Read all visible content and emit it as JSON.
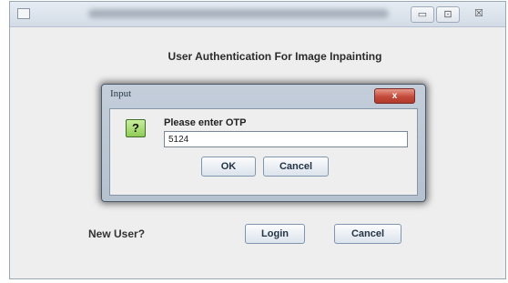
{
  "main": {
    "heading": "User Authentication For Image Inpainting",
    "new_user_label": "New User?",
    "login_button": "Login",
    "cancel_button": "Cancel"
  },
  "window_controls": {
    "minimize": "▭",
    "maximize": "⊡",
    "close": "☒"
  },
  "dialog": {
    "title": "Input",
    "close_glyph": "x",
    "prompt": "Please enter OTP",
    "icon_glyph": "?",
    "otp_value": "5124",
    "ok_button": "OK",
    "cancel_button": "Cancel"
  },
  "colors": {
    "dialog_close": "#c44a3a",
    "question_icon": "#8fcb56"
  }
}
